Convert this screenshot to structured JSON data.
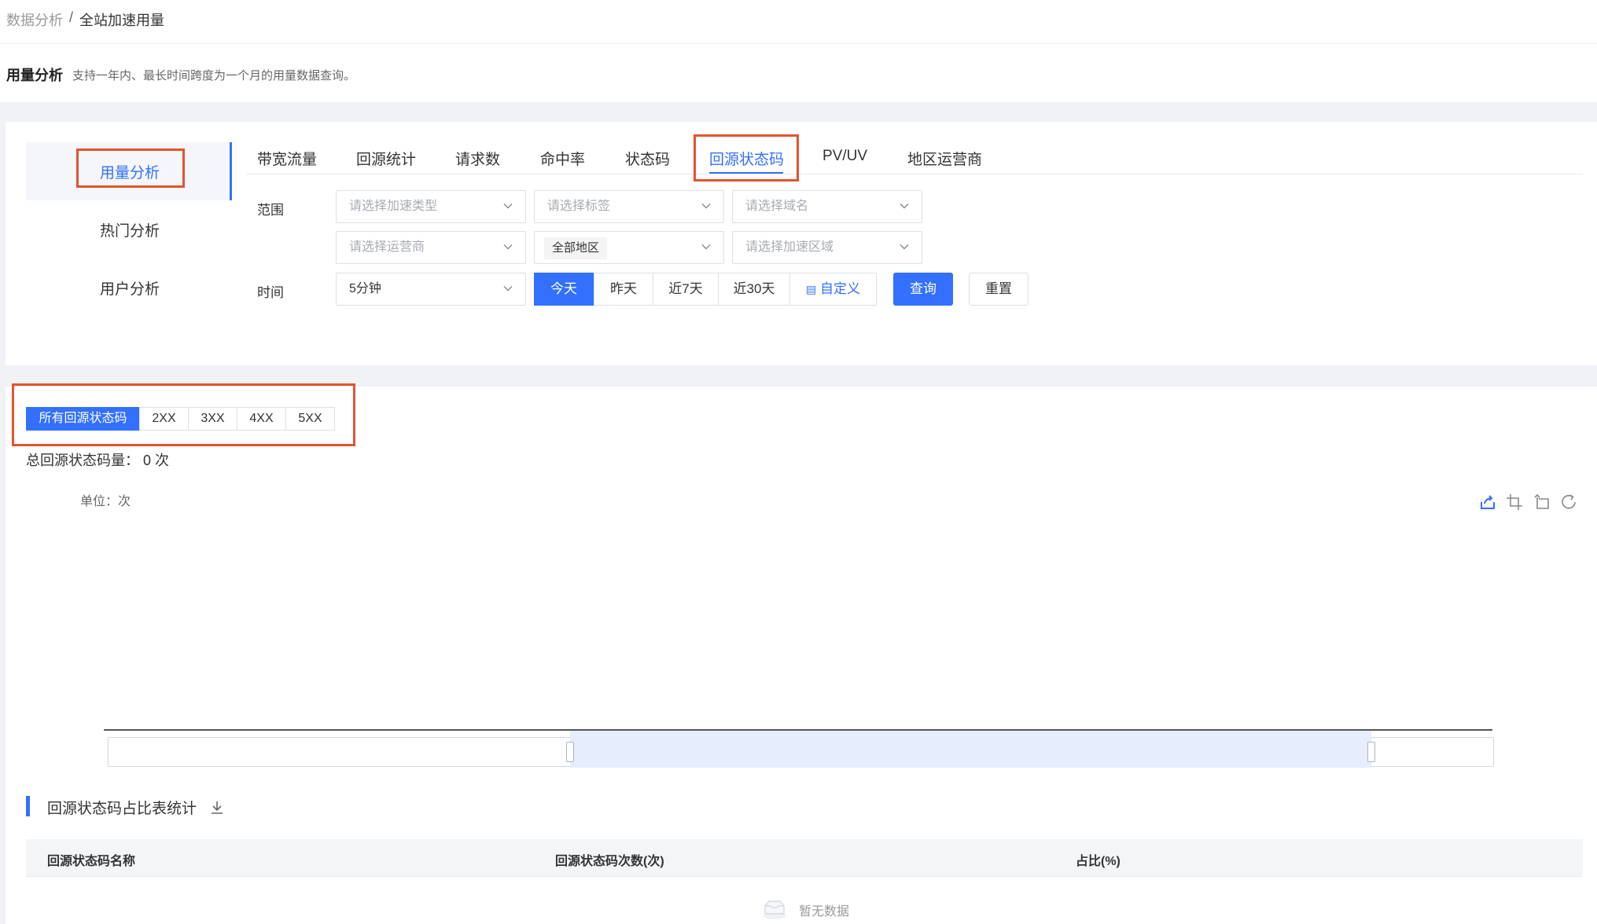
{
  "breadcrumb": {
    "parent": "数据分析",
    "separator": "/",
    "current": "全站加速用量"
  },
  "header": {
    "title": "用量分析",
    "description": "支持一年内、最长时间跨度为一个月的用量数据查询。"
  },
  "sidebar": {
    "items": [
      {
        "label": "用量分析",
        "active": true
      },
      {
        "label": "热门分析",
        "active": false
      },
      {
        "label": "用户分析",
        "active": false
      }
    ]
  },
  "tabs": [
    {
      "label": "带宽流量"
    },
    {
      "label": "回源统计"
    },
    {
      "label": "请求数"
    },
    {
      "label": "命中率"
    },
    {
      "label": "状态码"
    },
    {
      "label": "回源状态码",
      "active": true
    },
    {
      "label": "PV/UV"
    },
    {
      "label": "地区运营商"
    }
  ],
  "filters": {
    "scope_label": "范围",
    "time_label": "时间",
    "accel_type_placeholder": "请选择加速类型",
    "tag_placeholder": "请选择标签",
    "domain_placeholder": "请选择域名",
    "isp_placeholder": "请选择运营商",
    "region_value": "全部地区",
    "accel_area_placeholder": "请选择加速区域",
    "granularity_value": "5分钟",
    "ranges": [
      "今天",
      "昨天",
      "近7天",
      "近30天"
    ],
    "active_range": "今天",
    "custom_label": "自定义",
    "query_button": "查询",
    "reset_button": "重置"
  },
  "status_codes": {
    "tabs": [
      "所有回源状态码",
      "2XX",
      "3XX",
      "4XX",
      "5XX"
    ],
    "active": "所有回源状态码",
    "total_label": "总回源状态码量：",
    "total_value": "0 次"
  },
  "chart": {
    "unit_label": "单位：次",
    "toolbox": [
      "export-icon",
      "zoom-select-icon",
      "zoom-reset-icon",
      "restore-icon"
    ],
    "datazoom_start_pct": 33.3,
    "datazoom_end_pct": 91.1
  },
  "table": {
    "title": "回源状态码占比表统计",
    "columns": [
      "回源状态码名称",
      "回源状态码次数(次)",
      "占比(%)"
    ],
    "empty_text": "暂无数据"
  },
  "colors": {
    "accent": "#3370ff",
    "highlight_box": "#e5532d"
  }
}
